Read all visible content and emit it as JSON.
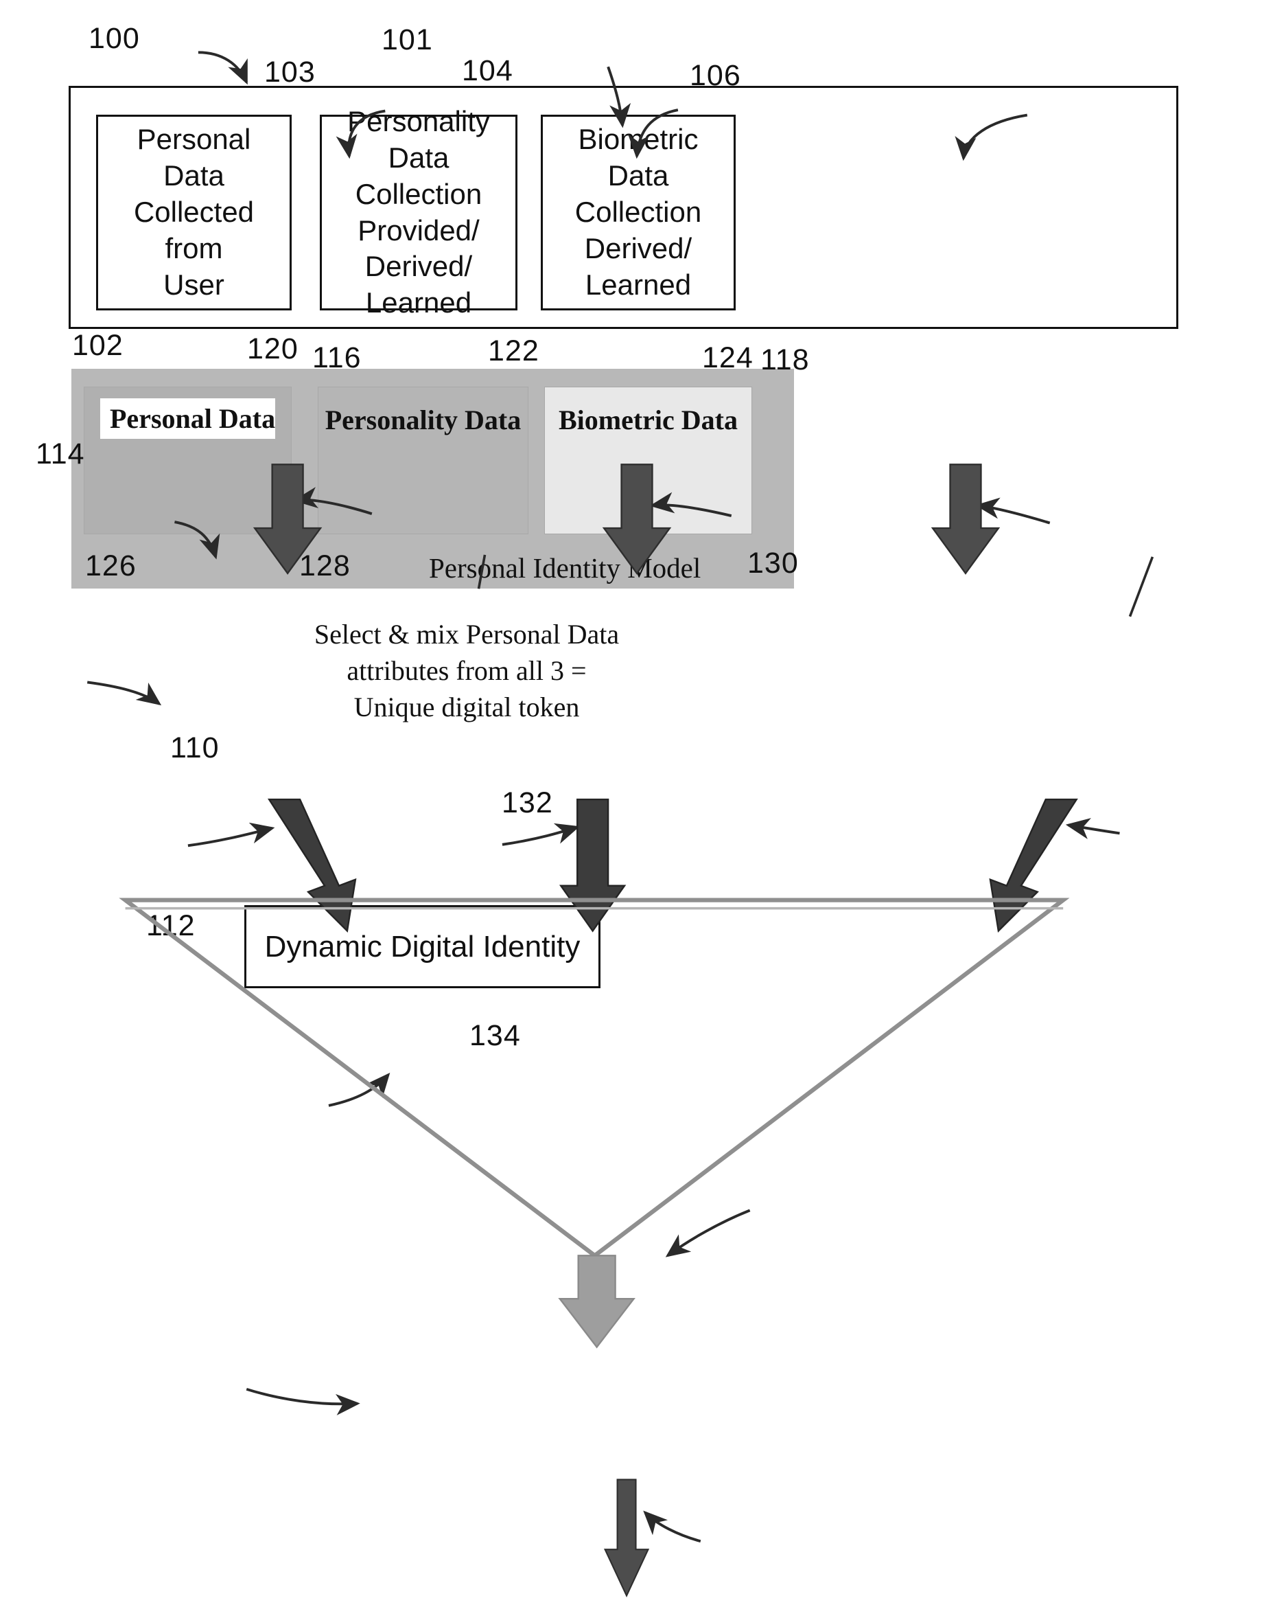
{
  "figure": {
    "title": "Personal Identity Model to Dynamic Digital Identity flow diagram",
    "colors": {
      "line": "#111111",
      "band_fill": "#b8b8b8",
      "cell_personal": "#b0b0b0",
      "cell_personality": "#b5b5b5",
      "cell_biometric": "#e8e8e8",
      "arrow_dark": "#4a4a4a",
      "funnel_outline": "#8a8a8a",
      "funnel_arrow": "#9a9a9a"
    }
  },
  "reference_numerals": {
    "n100": "100",
    "n101": "101",
    "n102": "102",
    "n103": "103",
    "n104": "104",
    "n106": "106",
    "n110": "110",
    "n112": "112",
    "n114": "114",
    "n116": "116",
    "n118": "118",
    "n120": "120",
    "n122": "122",
    "n124": "124",
    "n126": "126",
    "n128": "128",
    "n130": "130",
    "n132": "132",
    "n134": "134"
  },
  "collection_sources": {
    "personal": "Personal\nData\nCollected\nfrom\nUser",
    "personality": "Personality\nData\nCollection\nProvided/\nDerived/\nLearned",
    "biometric": "Biometric\nData\nCollection\nDerived/\nLearned"
  },
  "identity_model": {
    "title": "Personal Identity Model",
    "cells": {
      "personal": "Personal Data",
      "personality": "Personality Data",
      "biometric": "Biometric Data"
    }
  },
  "funnel": {
    "text": "Select & mix Personal Data\nattributes from all 3 =\nUnique digital token"
  },
  "output": {
    "label": "Dynamic Digital Identity"
  }
}
